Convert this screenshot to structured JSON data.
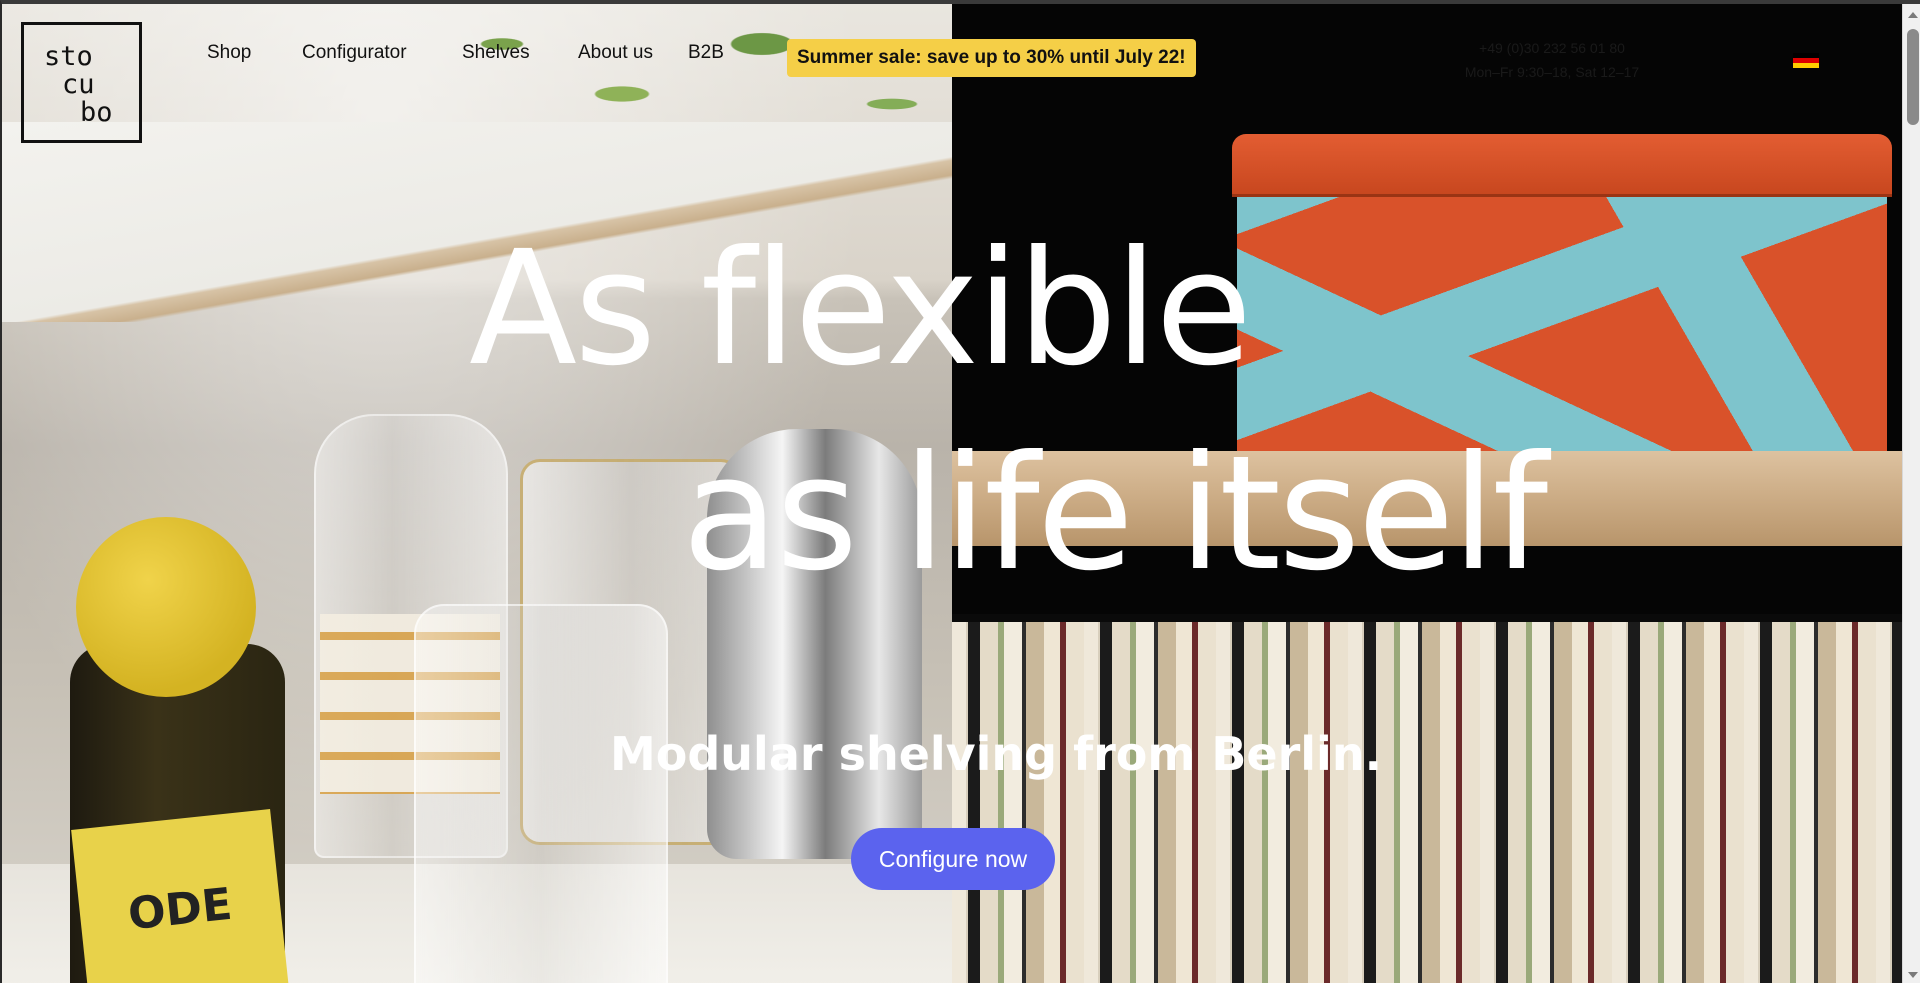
{
  "brand": {
    "logo_line1": "sto",
    "logo_line2": "cu",
    "logo_line3": "bo"
  },
  "nav": {
    "items": [
      {
        "label": "Shop"
      },
      {
        "label": "Configurator"
      },
      {
        "label": "Shelves"
      },
      {
        "label": "About us"
      },
      {
        "label": "B2B"
      }
    ]
  },
  "promo": {
    "text": "Summer sale: save up to 30% until July 22!",
    "color": "#f5cf47"
  },
  "contact": {
    "phone": "+49 (0)30 232 56 01 80",
    "hours": "Mon–Fr 9:30–18, Sat 12–17"
  },
  "language": {
    "flag": "germany-flag-icon"
  },
  "hero": {
    "headline_line1": "As flexible",
    "headline_line2": "as life itself",
    "subheadline": "Modular shelving from Berlin.",
    "cta_label": "Configure now",
    "cta_color": "#5b63ee",
    "left_image_label": "ODE"
  }
}
